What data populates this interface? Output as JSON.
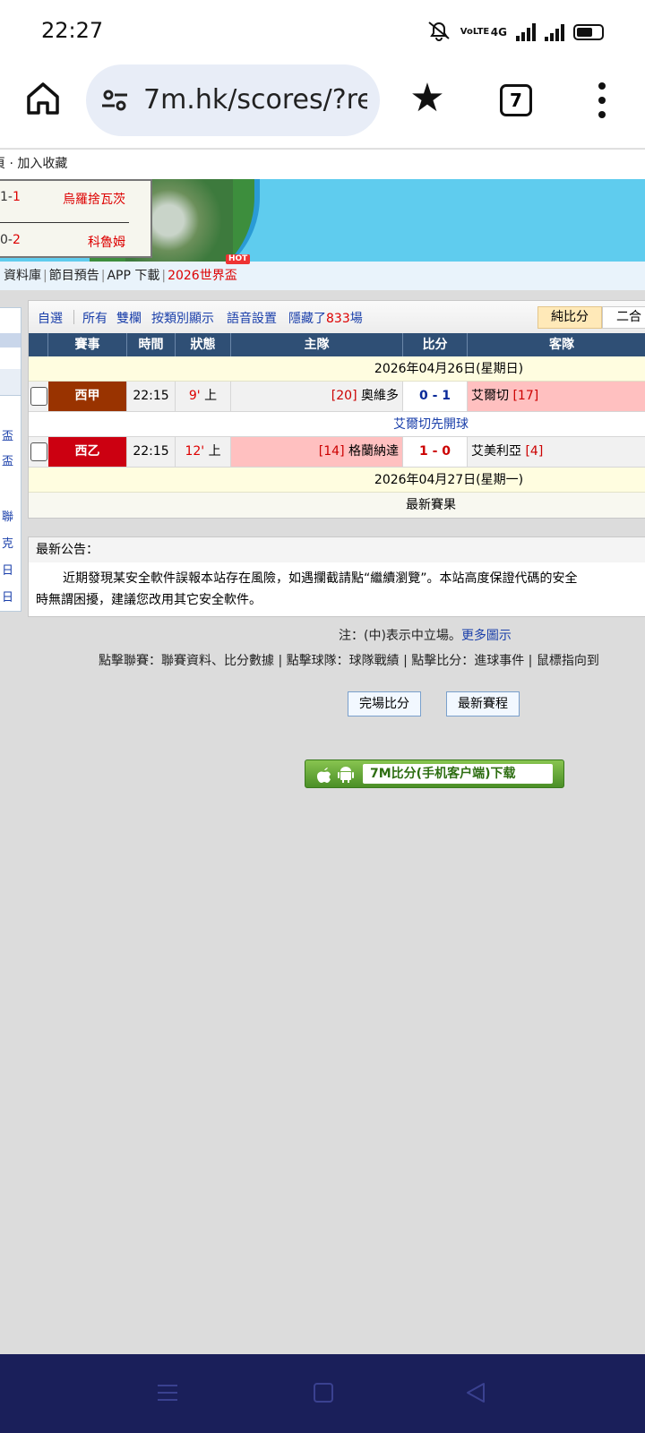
{
  "status": {
    "time": "22:27",
    "net": "4G",
    "volte": "VoLTE"
  },
  "browser": {
    "url": "7m.hk/scores/?re",
    "tab_count": "7"
  },
  "page": {
    "topnav": "頁 · 加入收藏",
    "banner": {
      "row1": {
        "score_a": "1",
        "score_b": "1",
        "team": "烏羅捨瓦茨"
      },
      "row2": {
        "score_a": "0",
        "score_b": "2",
        "team": "科魯姆"
      }
    },
    "subnav": {
      "items": [
        "資料庫",
        "節目預告",
        "APP 下載"
      ],
      "hot_item": "2026世界盃",
      "hot_badge": "HOT"
    },
    "left_chars": [
      "盃",
      "盃",
      "聯",
      "克",
      "日",
      "日"
    ],
    "toolbar": {
      "opt_fav": "自選",
      "opt_all": "所有",
      "opt_dual": "雙欄",
      "opt_type": "按類別顯示",
      "opt_voice": "語音設置",
      "hidden_prefix": "隱藏了",
      "hidden_count": "833",
      "hidden_suffix": "場",
      "pure_score": "純比分",
      "two_in_one": "二合"
    },
    "headers": {
      "event": "賽事",
      "time": "時間",
      "status": "狀態",
      "home": "主隊",
      "score": "比分",
      "away": "客隊"
    },
    "date1": "2026年04月26日(星期日)",
    "matches": [
      {
        "league": "西甲",
        "league_color": "#993300",
        "time": "22:15",
        "minute": "9'",
        "half": "上",
        "home_rank": "[20]",
        "home": "奧維多",
        "score_home": "0",
        "score_away": "1",
        "score_sep": "-",
        "away": "艾爾切",
        "away_rank": "[17]",
        "home_bg": "#f1f1f1",
        "away_bg": "#ffc0c0",
        "score_color": "#0a2a99"
      },
      {
        "league": "西乙",
        "league_color": "#cc0011",
        "time": "22:15",
        "minute": "12'",
        "half": "上",
        "home_rank": "[14]",
        "home": "格蘭納達",
        "score_home": "1",
        "score_away": "0",
        "score_sep": "-",
        "away": "艾美利亞",
        "away_rank": "[4]",
        "home_bg": "#ffc0c0",
        "away_bg": "#f1f1f1",
        "score_color": "#cc0000"
      }
    ],
    "kickoff_note": "艾爾切先開球",
    "date2": "2026年04月27日(星期一)",
    "latest_results": "最新賽果",
    "notice": {
      "title": "最新公告：",
      "line1": "近期發現某安全軟件誤報本站存在風險，如遇攔截請點“繼續瀏覽”。本站高度保證代碼的安全",
      "line2": "時無謂困擾，建議您改用其它安全軟件。"
    },
    "notes": {
      "neutral": "注：(中)表示中立場。",
      "more_icons": "更多圖示",
      "help": "點擊聯賽：聯賽資料、比分數據 | 點擊球隊：球隊戰績 | 點擊比分：進球事件 | 鼠標指向到"
    },
    "buttons": {
      "full_score": "完場比分",
      "latest_fixtures": "最新賽程"
    },
    "app_download": "7M比分(手机客户端)下载"
  }
}
